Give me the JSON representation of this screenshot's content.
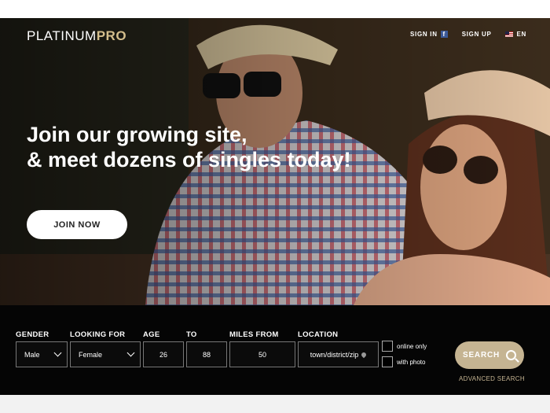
{
  "brand": {
    "name_part1": "PLATINUM",
    "name_part2": "PRO"
  },
  "nav": {
    "sign_in": "SIGN IN",
    "facebook_icon": "facebook-icon",
    "sign_up": "SIGN UP",
    "lang": "EN",
    "flag_icon": "us-flag-icon"
  },
  "hero": {
    "headline_line1": "Join our growing site,",
    "headline_line2": "& meet dozens of singles today!",
    "join_label": "JOIN NOW"
  },
  "search": {
    "gender_label": "GENDER",
    "gender_value": "Male",
    "looking_label": "LOOKING FOR",
    "looking_value": "Female",
    "age_label": "AGE",
    "age_min": "26",
    "to_label": "TO",
    "age_max": "88",
    "miles_label": "MILES FROM",
    "miles_value": "50",
    "location_label": "LOCATION",
    "location_placeholder": "town/district/zip",
    "online_only_label": "online only",
    "with_photo_label": "with photo",
    "search_label": "SEARCH",
    "advanced_label": "ADVANCED SEARCH"
  },
  "colors": {
    "accent": "#c5b492",
    "bar_bg": "#050505"
  }
}
